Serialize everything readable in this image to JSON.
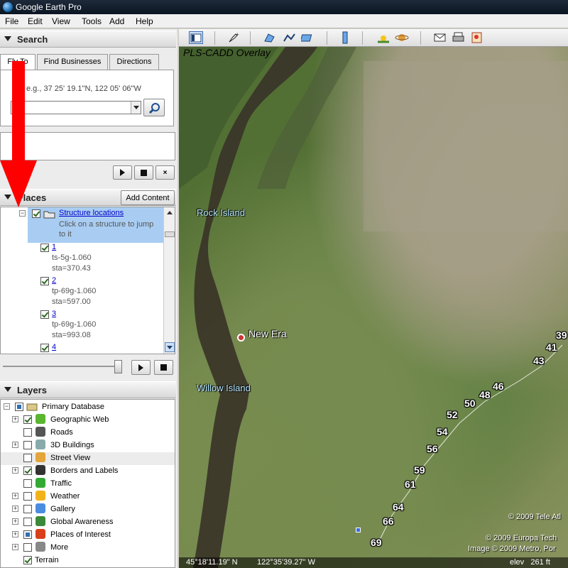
{
  "window": {
    "title": "Google Earth Pro"
  },
  "menu": [
    "File",
    "Edit",
    "View",
    "Tools",
    "Add",
    "Help"
  ],
  "search": {
    "title": "Search",
    "tabs": [
      "Fly To",
      "Find Businesses",
      "Directions"
    ],
    "hint": "e.g., 37 25' 19.1\"N, 122 05' 06\"W",
    "input_value": ""
  },
  "places": {
    "title": "Places",
    "add_content": "Add Content",
    "folder": {
      "name": "Structure locations",
      "desc": "Click on a structure to jump to it"
    },
    "items": [
      {
        "label": "1",
        "line1": "ts-5g-1.060",
        "line2": "sta=370.43"
      },
      {
        "label": "2",
        "line1": "tp-69g-1.060",
        "line2": "sta=597.00"
      },
      {
        "label": "3",
        "line1": "tp-69g-1.060",
        "line2": "sta=993.08"
      },
      {
        "label": "4"
      }
    ]
  },
  "layers": {
    "title": "Layers",
    "root": "Primary Database",
    "items": [
      {
        "label": "Geographic Web",
        "checked": true,
        "icon": "star-icon"
      },
      {
        "label": "Roads",
        "checked": false,
        "icon": "road-icon"
      },
      {
        "label": "3D Buildings",
        "checked": false,
        "icon": "building-icon"
      },
      {
        "label": "Street View",
        "checked": false,
        "icon": "pegman-icon"
      },
      {
        "label": "Borders and Labels",
        "checked": true,
        "icon": "flag-icon"
      },
      {
        "label": "Traffic",
        "checked": false,
        "icon": "traffic-light-icon"
      },
      {
        "label": "Weather",
        "checked": false,
        "icon": "sun-icon"
      },
      {
        "label": "Gallery",
        "checked": false,
        "icon": "gallery-star-icon"
      },
      {
        "label": "Global Awareness",
        "checked": false,
        "icon": "globe-icon"
      },
      {
        "label": "Places of Interest",
        "checked": "partial",
        "icon": "poi-flag-icon"
      },
      {
        "label": "More",
        "checked": false,
        "icon": "more-icon"
      },
      {
        "label": "Terrain",
        "checked": true,
        "icon": ""
      }
    ]
  },
  "map": {
    "overlay_title": "PLS-CADD Overlay",
    "labels": [
      "Rock Island",
      "New Era",
      "Willow Island"
    ],
    "stations": [
      "39",
      "41",
      "43",
      "46",
      "48",
      "50",
      "52",
      "54",
      "56",
      "59",
      "61",
      "64",
      "66",
      "69"
    ],
    "copyrights": [
      "© 2009 Tele Atl",
      "© 2009 Europa Tech",
      "Image © 2009 Metro, Por"
    ],
    "status": {
      "lat": "45°18'11.19\" N",
      "lon": "122°35'39.27\" W",
      "elev": "elev   261 ft"
    }
  },
  "colors": {
    "selection": "#a9cdf2",
    "accent": "#0000cc",
    "arrow": "#ff0000"
  }
}
